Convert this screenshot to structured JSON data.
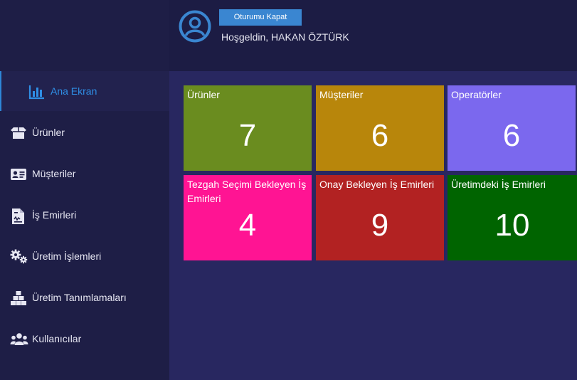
{
  "header": {
    "logout_label": "Oturumu Kapat",
    "welcome_text": "Hoşgeldin, HAKAN ÖZTÜRK"
  },
  "sidebar": {
    "items": [
      {
        "label": "Ana Ekran",
        "icon": "bar-chart-icon",
        "active": true
      },
      {
        "label": "Ürünler",
        "icon": "box-icon"
      },
      {
        "label": "Müşteriler",
        "icon": "id-card-icon"
      },
      {
        "label": "İş Emirleri",
        "icon": "document-icon"
      },
      {
        "label": "Üretim İşlemleri",
        "icon": "gears-icon"
      },
      {
        "label": "Üretim Tanımlamaları",
        "icon": "cubes-icon"
      },
      {
        "label": "Kullanıcılar",
        "icon": "users-icon"
      }
    ]
  },
  "dashboard": {
    "tiles": [
      {
        "label": "Ürünler",
        "value": "7",
        "color": "#6a8c1f"
      },
      {
        "label": "Müşteriler",
        "value": "6",
        "color": "#b8860b"
      },
      {
        "label": "Operatörler",
        "value": "6",
        "color": "#7b68ee"
      },
      {
        "label": "Tezgah Seçimi Bekleyen İş Emirleri",
        "value": "4",
        "color": "#ff1493"
      },
      {
        "label": "Onay Bekleyen İş Emirleri",
        "value": "9",
        "color": "#b22222"
      },
      {
        "label": "Üretimdeki İş Emirleri",
        "value": "10",
        "color": "#006400"
      }
    ]
  },
  "colors": {
    "accent": "#2f8fe6",
    "sidebar_bg": "#1e1e46",
    "content_bg": "#282760"
  }
}
